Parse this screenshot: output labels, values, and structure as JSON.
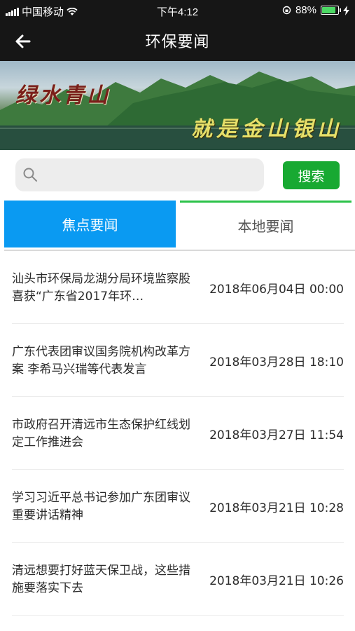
{
  "status_bar": {
    "carrier": "中国移动",
    "time": "下午4:12",
    "battery": "88%"
  },
  "nav": {
    "title": "环保要闻"
  },
  "banner": {
    "text_left": "绿水青山",
    "text_right": "就是金山银山"
  },
  "search": {
    "placeholder": "",
    "button_label": "搜索"
  },
  "tabs": [
    {
      "label": "焦点要闻",
      "active": true
    },
    {
      "label": "本地要闻",
      "active": false
    }
  ],
  "news": [
    {
      "title": "汕头市环保局龙湖分局环境监察股喜获“广东省2017年环…",
      "date": "2018年06月04日 00:00"
    },
    {
      "title": "广东代表团审议国务院机构改革方案 李希马兴瑞等代表发言",
      "date": "2018年03月28日 18:10"
    },
    {
      "title": "市政府召开清远市生态保护红线划定工作推进会",
      "date": "2018年03月27日 11:54"
    },
    {
      "title": "学习习近平总书记参加广东团审议重要讲话精神",
      "date": "2018年03月21日 10:28"
    },
    {
      "title": "清远想要打好蓝天保卫战，这些措施要落实下去",
      "date": "2018年03月21日 10:26"
    }
  ],
  "colors": {
    "active_tab": "#0a9af2",
    "search_button": "#18a932",
    "tab_accent": "#2cc24a"
  }
}
